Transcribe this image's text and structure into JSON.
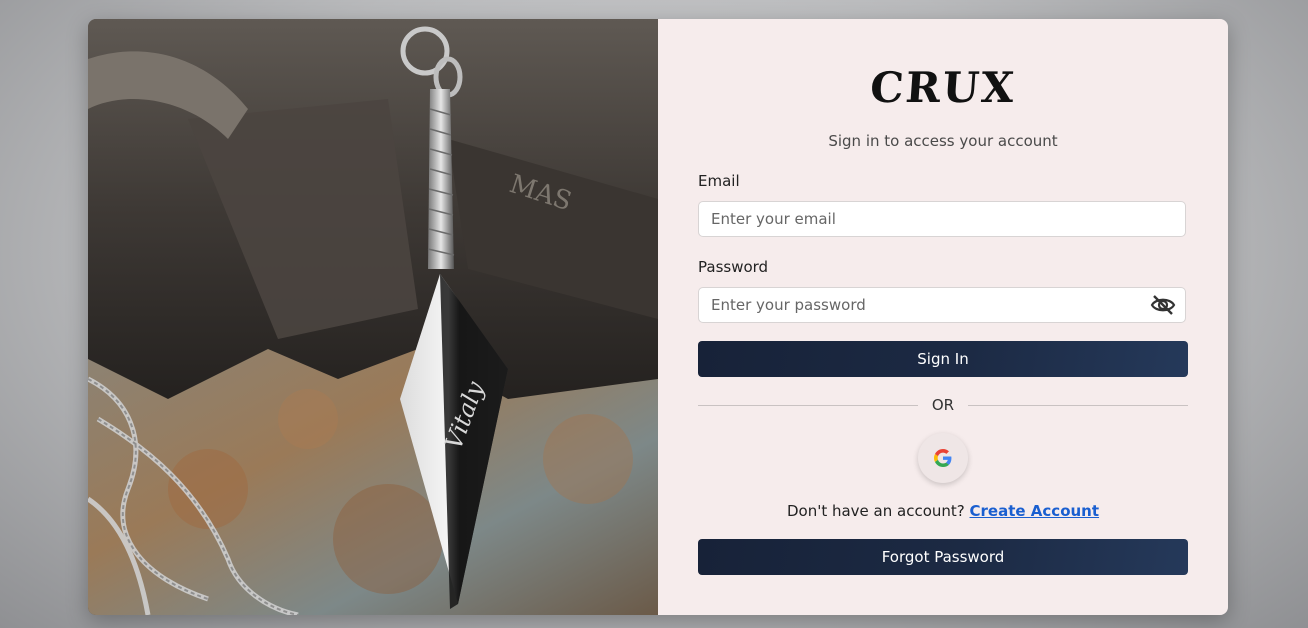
{
  "brand": {
    "logo_text": "CRUX",
    "subtitle": "Sign in to access your account"
  },
  "form": {
    "email_label": "Email",
    "email_placeholder": "Enter your email",
    "email_value": "",
    "password_label": "Password",
    "password_placeholder": "Enter your password",
    "password_value": "",
    "password_toggle_icon": "eye-off-icon",
    "sign_in_label": "Sign In",
    "divider_text": "OR",
    "google_icon": "google-icon"
  },
  "signup": {
    "prompt": "Don't have an account?",
    "link_label": "Create Account"
  },
  "forgot_password_label": "Forgot Password",
  "image": {
    "engraving": "Vitaly",
    "anvil_text": "MAS"
  },
  "colors": {
    "button_bg": "#1c2a44",
    "panel_bg": "#f6ecec",
    "link": "#1a5fd0"
  }
}
